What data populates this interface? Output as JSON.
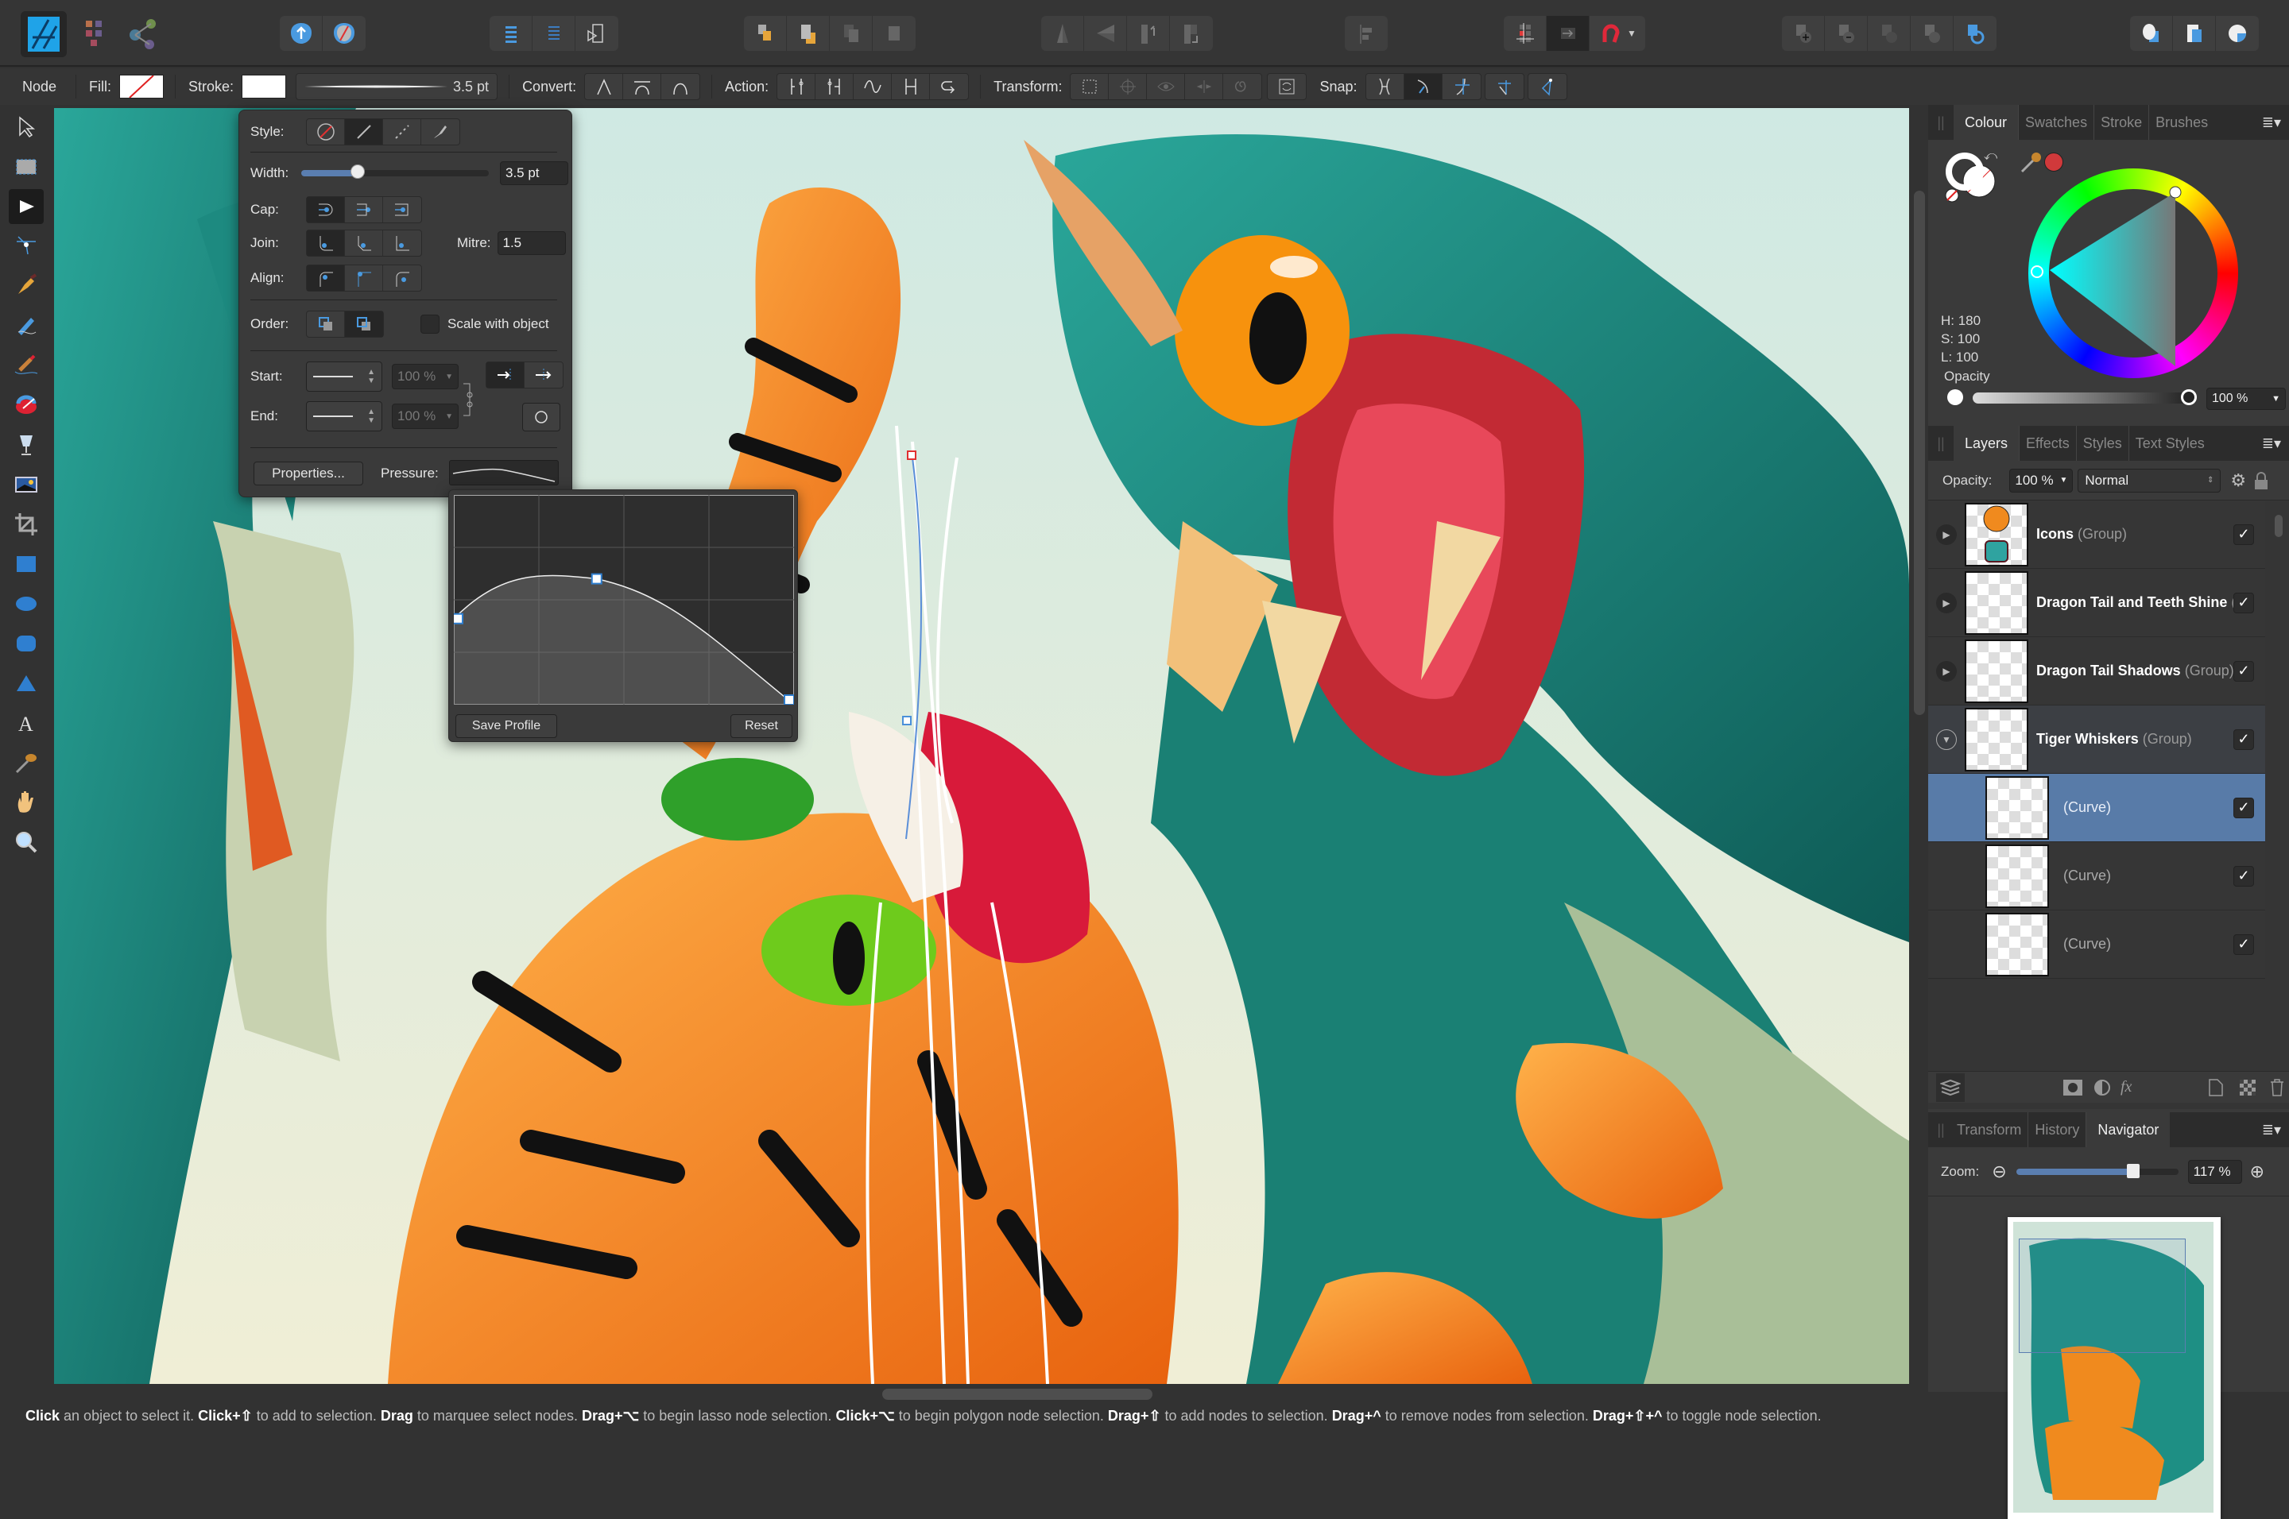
{
  "app": {
    "name": "Affinity Designer",
    "accent": "#4a90d9",
    "selection_color": "#587ba8"
  },
  "toolbar": {
    "persona_icons": [
      "designer-persona-icon",
      "pixel-persona-icon",
      "export-persona-icon"
    ],
    "groups": [
      {
        "name": "quick-actions",
        "icons": [
          "move-forward-icon",
          "move-back-icon"
        ]
      },
      {
        "name": "isolate",
        "icons": [
          "distribute-icon",
          "align-icon",
          "insert-target-icon"
        ]
      },
      {
        "name": "arrange",
        "icons": [
          "move-to-back-icon",
          "move-back-one-icon",
          "move-forward-one-icon",
          "move-to-front-icon"
        ]
      },
      {
        "name": "flip-rotate",
        "icons": [
          "flip-horizontal-icon",
          "flip-vertical-icon",
          "rotate-left-icon",
          "rotate-right-icon"
        ]
      },
      {
        "name": "align",
        "icons": [
          "alignment-icon"
        ]
      },
      {
        "name": "snap",
        "icons": [
          "snap-grid-icon",
          "snap-toggle-icon",
          "magnet-icon"
        ]
      },
      {
        "name": "boolean",
        "icons": [
          "add-icon",
          "subtract-icon",
          "intersect-icon",
          "xor-icon",
          "divide-icon"
        ]
      },
      {
        "name": "view",
        "icons": [
          "studio-icon",
          "assistant-icon",
          "preferences-icon"
        ]
      }
    ]
  },
  "context": {
    "tool_name": "Node",
    "fill_label": "Fill:",
    "stroke_label": "Stroke:",
    "stroke_width": "3.5 pt",
    "convert_label": "Convert:",
    "action_label": "Action:",
    "transform_label": "Transform:",
    "snap_label": "Snap:"
  },
  "stroke_panel": {
    "style_label": "Style:",
    "width_label": "Width:",
    "width_value": "3.5 pt",
    "width_fraction": 0.3,
    "cap_label": "Cap:",
    "join_label": "Join:",
    "mitre_label": "Mitre:",
    "mitre_value": "1.5",
    "align_label": "Align:",
    "order_label": "Order:",
    "scale_label": "Scale with object",
    "start_label": "Start:",
    "end_label": "End:",
    "start_pct": "100 %",
    "end_pct": "100 %",
    "properties_btn": "Properties...",
    "pressure_label": "Pressure:",
    "save_profile": "Save Profile",
    "reset": "Reset",
    "pressure_curve": [
      [
        0,
        0.41
      ],
      [
        0.42,
        0.6
      ],
      [
        1,
        0.0
      ]
    ]
  },
  "colour_panel": {
    "tabs": [
      "Colour",
      "Swatches",
      "Stroke",
      "Brushes"
    ],
    "active_tab": "Colour",
    "h": "H: 180",
    "s": "S: 100",
    "l": "L: 100",
    "opacity_label": "Opacity",
    "opacity_value": "100 %",
    "recent_color": "#d0393b"
  },
  "layers_panel": {
    "tabs": [
      "Layers",
      "Effects",
      "Styles",
      "Text Styles"
    ],
    "active_tab": "Layers",
    "opacity_label": "Opacity:",
    "opacity_value": "100 %",
    "blend_mode": "Normal",
    "layers": [
      {
        "name": "Icons",
        "type": "(Group)",
        "expanded": false,
        "visible": true,
        "level": 0
      },
      {
        "name": "Dragon Tail and Teeth Shine",
        "type": "(Group)",
        "expanded": false,
        "visible": true,
        "level": 0
      },
      {
        "name": "Dragon Tail Shadows",
        "type": "(Group)",
        "expanded": false,
        "visible": true,
        "level": 0
      },
      {
        "name": "Tiger Whiskers",
        "type": "(Group)",
        "expanded": true,
        "visible": true,
        "level": 0
      },
      {
        "name": "",
        "type": "(Curve)",
        "selected": true,
        "visible": true,
        "level": 1
      },
      {
        "name": "",
        "type": "(Curve)",
        "visible": true,
        "level": 1
      },
      {
        "name": "",
        "type": "(Curve)",
        "visible": true,
        "level": 1
      }
    ]
  },
  "navigator_panel": {
    "tabs": [
      "Transform",
      "History",
      "Navigator"
    ],
    "active_tab": "Navigator",
    "zoom_label": "Zoom:",
    "zoom_value": "117 %",
    "zoom_fraction": 0.72
  },
  "status_bar": [
    {
      "b": "Click",
      "t": " an object to select it. "
    },
    {
      "b": "Click+⇧",
      "t": " to add to selection. "
    },
    {
      "b": "Drag",
      "t": " to marquee select nodes. "
    },
    {
      "b": "Drag+⌥",
      "t": " to begin lasso node selection. "
    },
    {
      "b": "Click+⌥",
      "t": " to begin polygon node selection. "
    },
    {
      "b": "Drag+⇧",
      "t": " to add nodes to selection. "
    },
    {
      "b": "Drag+^",
      "t": " to remove nodes from selection. "
    },
    {
      "b": "Drag+⇧+^",
      "t": " to toggle node selection."
    }
  ],
  "tools": [
    "move-tool-icon",
    "artboard-tool-icon",
    "node-tool-icon",
    "point-transform-icon",
    "pen-tool-icon",
    "pencil-tool-icon",
    "vector-brush-icon",
    "fill-tool-icon",
    "transparency-tool-icon",
    "place-image-icon",
    "crop-tool-icon",
    "rectangle-tool-icon",
    "ellipse-tool-icon",
    "rounded-rect-icon",
    "triangle-tool-icon",
    "text-tool-icon",
    "color-picker-icon",
    "view-tool-icon",
    "zoom-tool-icon"
  ]
}
